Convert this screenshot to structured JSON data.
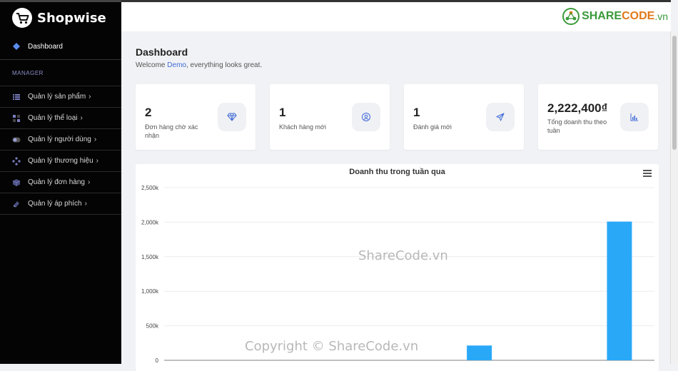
{
  "app": {
    "name": "Shopwise"
  },
  "sidebar": {
    "dashboard": "Dashboard",
    "section": "MANAGER",
    "items": [
      {
        "label": "Quản lý sản phẩm"
      },
      {
        "label": "Quản lý thể loại"
      },
      {
        "label": "Quản lý người dùng"
      },
      {
        "label": "Quản lý thương hiệu"
      },
      {
        "label": "Quản lý đơn hàng"
      },
      {
        "label": "Quản lý áp phích"
      }
    ]
  },
  "topbar": {
    "brand_a": "SHARE",
    "brand_b": "CODE",
    "brand_c": ".vn"
  },
  "page": {
    "title": "Dashboard",
    "welcome_pre": "Welcome ",
    "user": "Demo",
    "welcome_post": ", everything looks great."
  },
  "cards": [
    {
      "value": "2",
      "label": "Đơn hàng chờ xác nhận",
      "icon": "diamond-icon"
    },
    {
      "value": "1",
      "label": "Khách hàng mới",
      "icon": "user-circle-icon"
    },
    {
      "value": "1",
      "label": "Đánh giá mới",
      "icon": "paper-plane-icon"
    },
    {
      "value": "2,222,400₫",
      "label": "Tổng doanh thu theo tuần",
      "icon": "chart-icon"
    }
  ],
  "chart_data": {
    "type": "bar",
    "title": "Doanh thu trong tuần qua",
    "y_ticks": [
      "0",
      "500k",
      "1,000k",
      "1,500k",
      "2,000k",
      "2,500k"
    ],
    "ylim": [
      0,
      2500000
    ],
    "values": [
      0,
      0,
      0,
      0,
      214000,
      0,
      2008400
    ],
    "color": "#2aa8f8",
    "grid": true
  },
  "watermarks": {
    "center": "ShareCode.vn",
    "bottom": "Copyright © ShareCode.vn"
  }
}
